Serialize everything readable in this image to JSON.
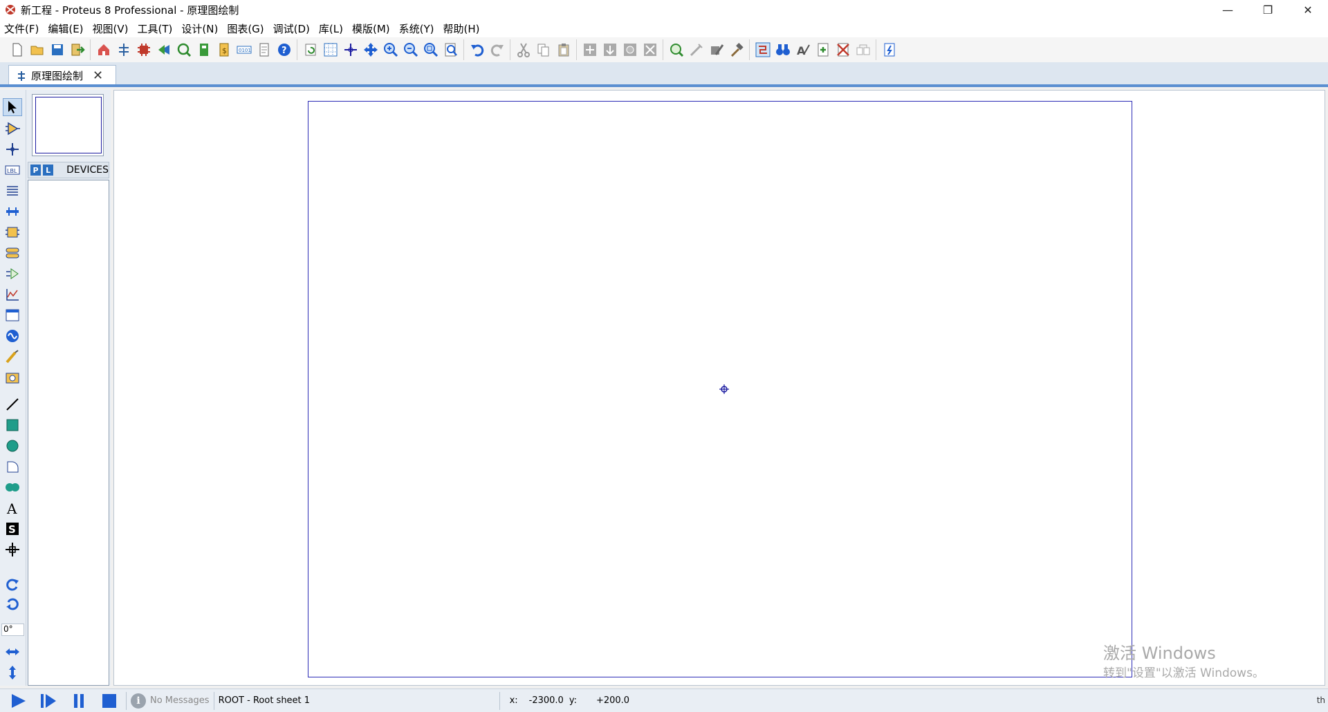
{
  "window": {
    "title": "新工程 - Proteus 8 Professional - 原理图绘制"
  },
  "menu": [
    "文件(F)",
    "编辑(E)",
    "视图(V)",
    "工具(T)",
    "设计(N)",
    "图表(G)",
    "调试(D)",
    "库(L)",
    "模版(M)",
    "系统(Y)",
    "帮助(H)"
  ],
  "tab": {
    "label": "原理图绘制"
  },
  "devices": {
    "p": "P",
    "l": "L",
    "label": "DEVICES"
  },
  "rotation": "0°",
  "watermark": {
    "line1": "激活 Windows",
    "line2": "转到\"设置\"以激活 Windows。"
  },
  "status": {
    "messages": "No Messages",
    "sheet": "ROOT - Root sheet 1",
    "x_label": "x:",
    "x_value": "-2300.0",
    "y_label": "y:",
    "y_value": "+200.0",
    "right": "th"
  },
  "colors": {
    "accent": "#2a6fc0",
    "sheet_border": "#2b2bb6"
  }
}
